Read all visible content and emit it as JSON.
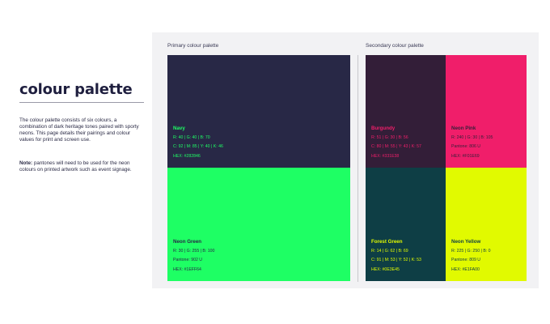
{
  "page": {
    "title": "colour palette",
    "intro": "The colour palette consists of six colours, a combination of dark heritage tones paired with sporty neons. This page details their pairings and colour values for print and screen use.",
    "note_label": "Note:",
    "note_text": " pantones will need to be used for the neon colours on printed artwork such as event signage."
  },
  "sections": {
    "primary": "Primary colour palette",
    "secondary": "Secondary colour palette"
  },
  "swatches": {
    "navy": {
      "name": "Navy",
      "bg": "#282846",
      "fg": "#1EFF64",
      "rgb": "R: 40  |  G: 40  |  B: 70",
      "cmyk": "C: 92  |  M: 85  |  Y: 40  |  K: 46",
      "hex": "HEX: #282846"
    },
    "neon_green": {
      "name": "Neon Green",
      "bg": "#1EFF64",
      "fg": "#282846",
      "rgb": "R: 30  |  G: 255  |  B: 100",
      "pantone": "Pantone: 902 U",
      "hex": "HEX: #1EFF64"
    },
    "burgundy": {
      "name": "Burgundy",
      "bg": "#331E38",
      "fg": "#F01E6A",
      "rgb": "R: 51  |  G: 30  |  B: 56",
      "cmyk": "C: 80  |  M: 55  |  Y: 43  |  K: 57",
      "hex": "HEX: #331E38"
    },
    "neon_pink": {
      "name": "Neon Pink",
      "bg": "#F01E6A",
      "fg": "#331E38",
      "rgb": "R: 240  |  G: 30  |  B: 105",
      "pantone": "Pantone: 806 U",
      "hex": "HEX: #F01E69"
    },
    "forest_green": {
      "name": "Forest Green",
      "bg": "#0E3E45",
      "fg": "#E1FA00",
      "rgb": "R: 14  |  G: 62  |  B: 69",
      "cmyk": "C: 91  |  M: 53  |  Y: 52  |  K: 53",
      "hex": "HEX: #0E3E45"
    },
    "neon_yellow": {
      "name": "Neon Yellow",
      "bg": "#E1FA00",
      "fg": "#0E3E45",
      "rgb": "R: 225  |  G: 250  |  B: 0",
      "pantone": "Pantone: 809 U",
      "hex": "HEX: #E1FA00"
    }
  }
}
